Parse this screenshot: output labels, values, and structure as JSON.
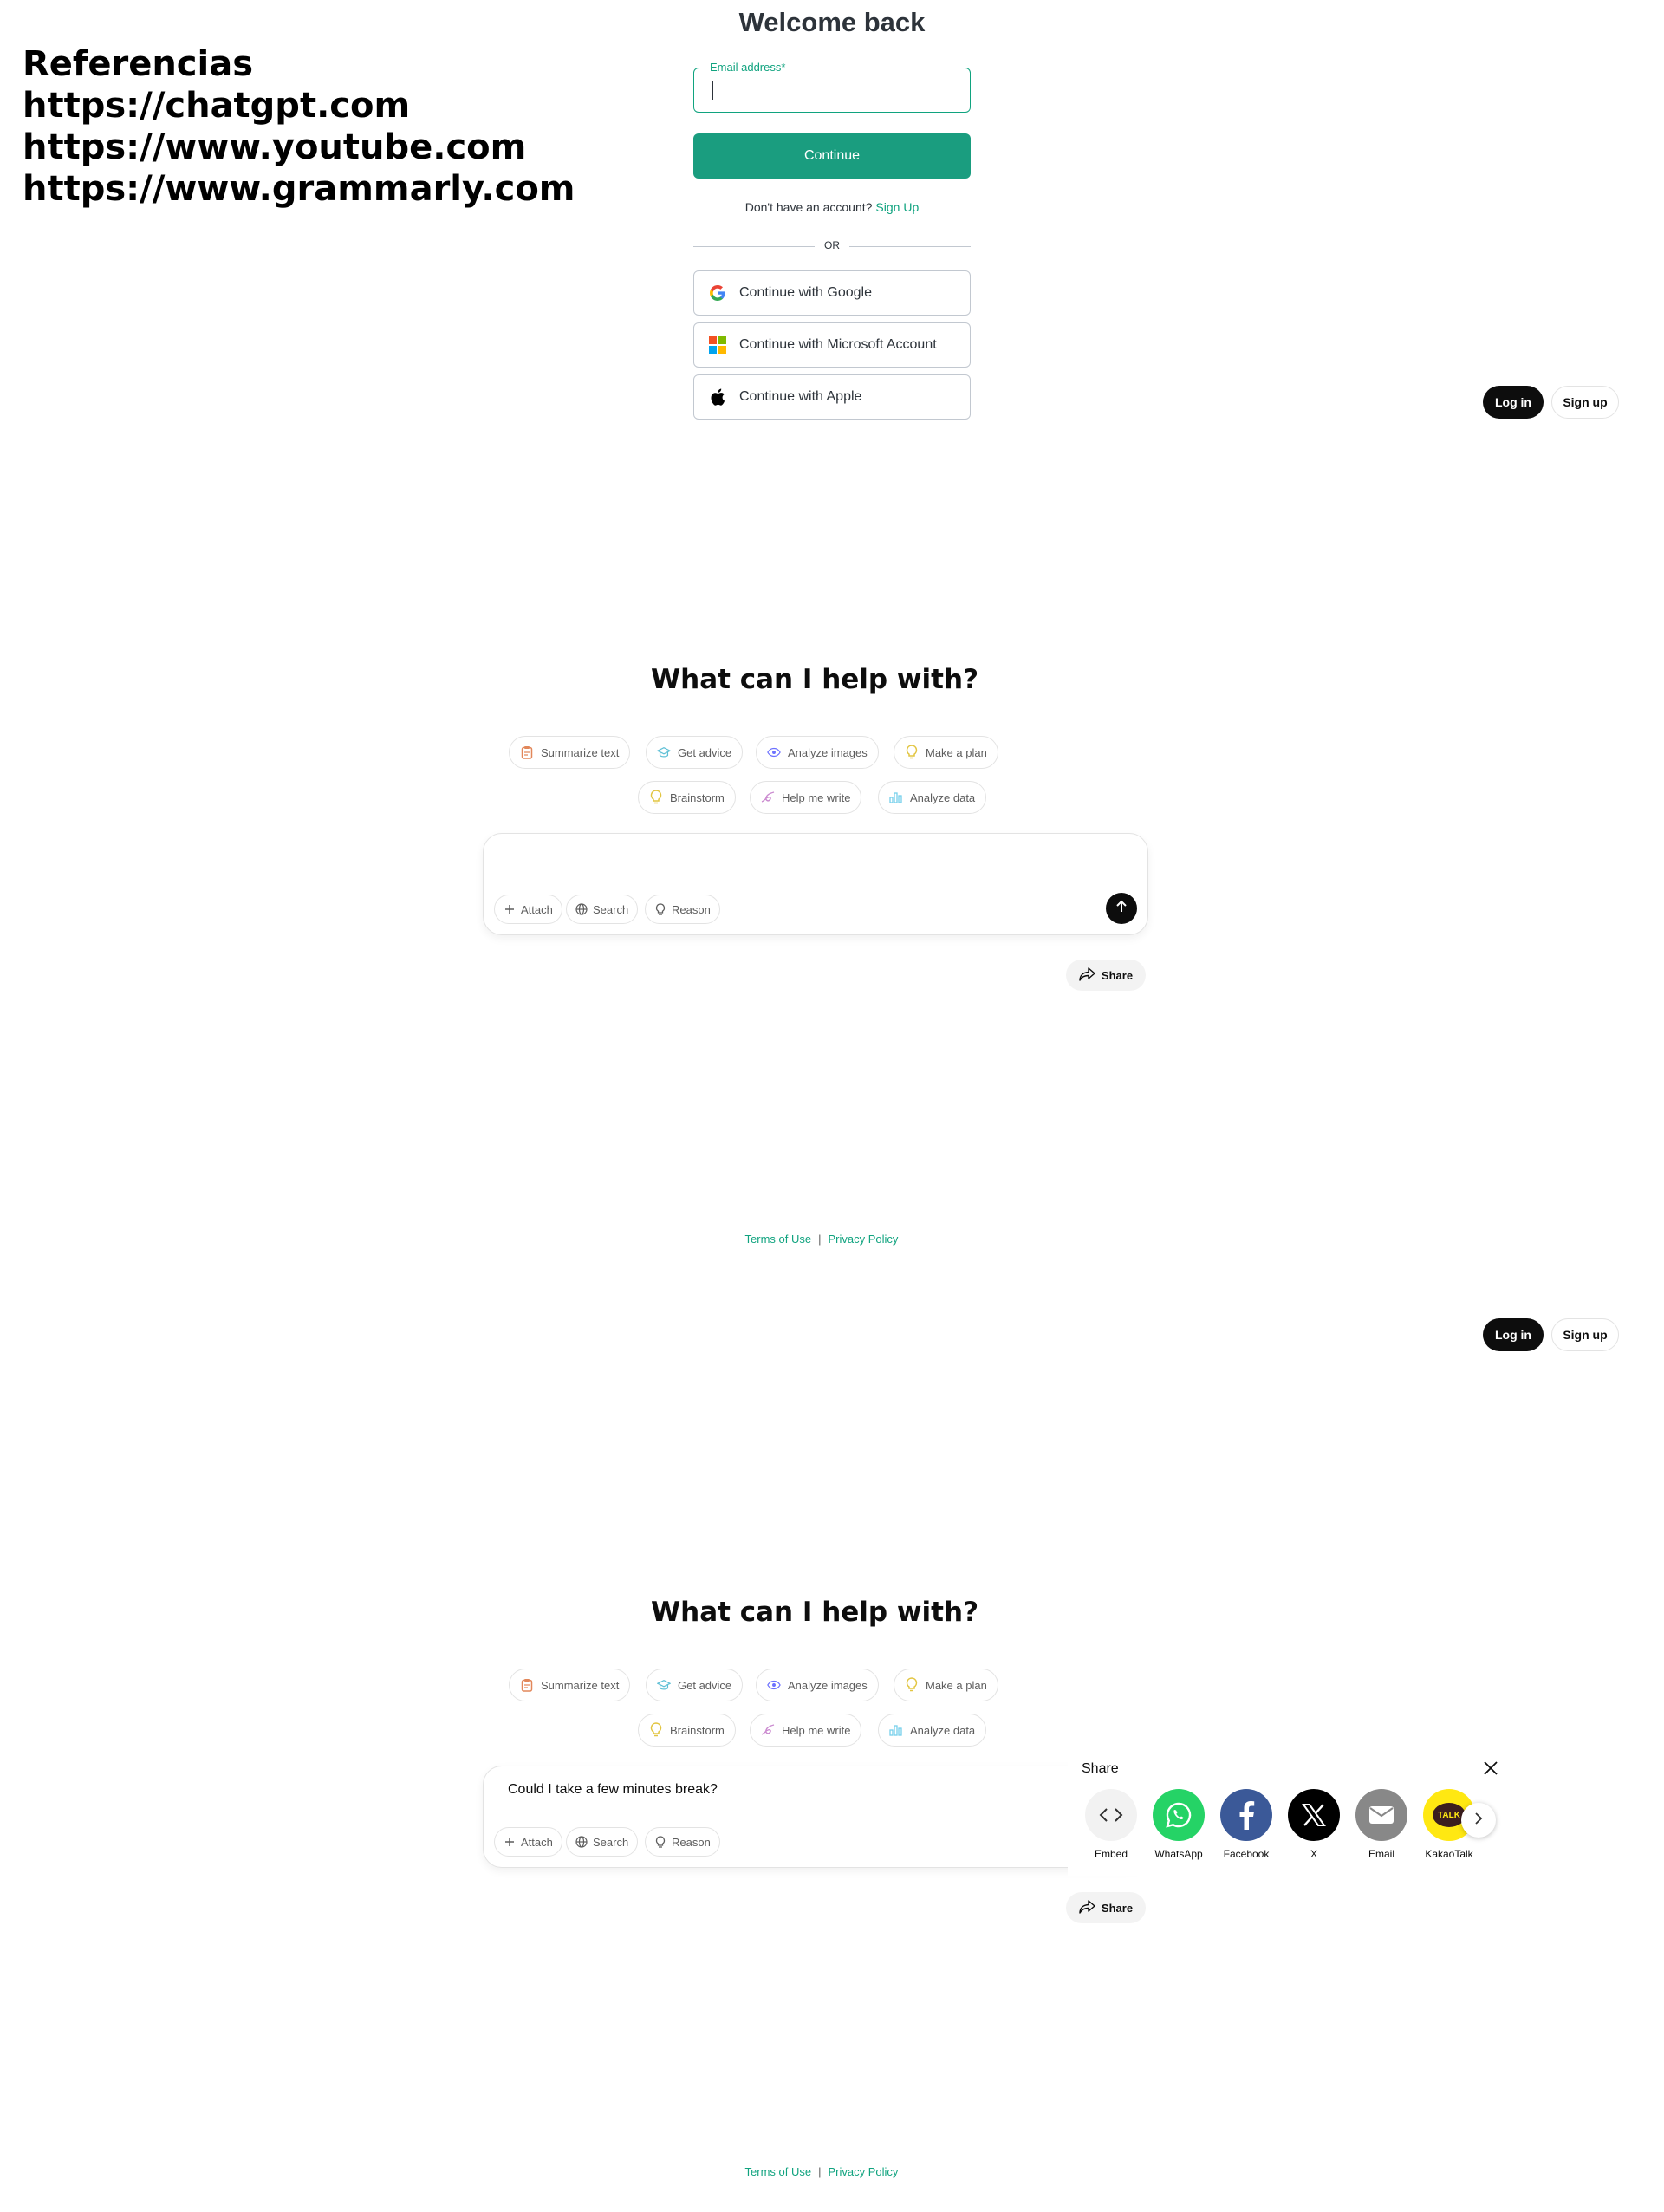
{
  "references": {
    "title": "Referencias",
    "links": [
      "https://chatgpt.com",
      "https://www.youtube.com",
      "https://www.grammarly.com"
    ]
  },
  "login": {
    "title": "Welcome back",
    "email_label": "Email address*",
    "email_value": "",
    "continue_label": "Continue",
    "no_account_text": "Don't have an account?",
    "signup_link": "Sign Up",
    "or_text": "OR",
    "google_label": "Continue with Google",
    "microsoft_label": "Continue with Microsoft Account",
    "apple_label": "Continue with Apple"
  },
  "header": {
    "login_label": "Log in",
    "signup_label": "Sign up"
  },
  "chat": {
    "headline": "What can I help with?",
    "chips": [
      "Summarize text",
      "Get advice",
      "Analyze images",
      "Make a plan",
      "Brainstorm",
      "Help me write",
      "Analyze data"
    ],
    "tools": [
      "Attach",
      "Search",
      "Reason"
    ],
    "share_label": "Share"
  },
  "chat_filled": {
    "composer_text": "Could I take a few minutes break?"
  },
  "footer": {
    "terms": "Terms of Use",
    "separator": "|",
    "privacy": "Privacy Policy"
  },
  "share_panel": {
    "title": "Share",
    "items": [
      "Embed",
      "WhatsApp",
      "Facebook",
      "X",
      "Email",
      "KakaoTalk"
    ],
    "kakao_badge": "TALK"
  },
  "colors": {
    "accent_green": "#10a37f",
    "whatsapp": "#25d366",
    "facebook": "#3b5998",
    "x": "#000000",
    "email": "#888888",
    "kakao": "#ffe812"
  }
}
